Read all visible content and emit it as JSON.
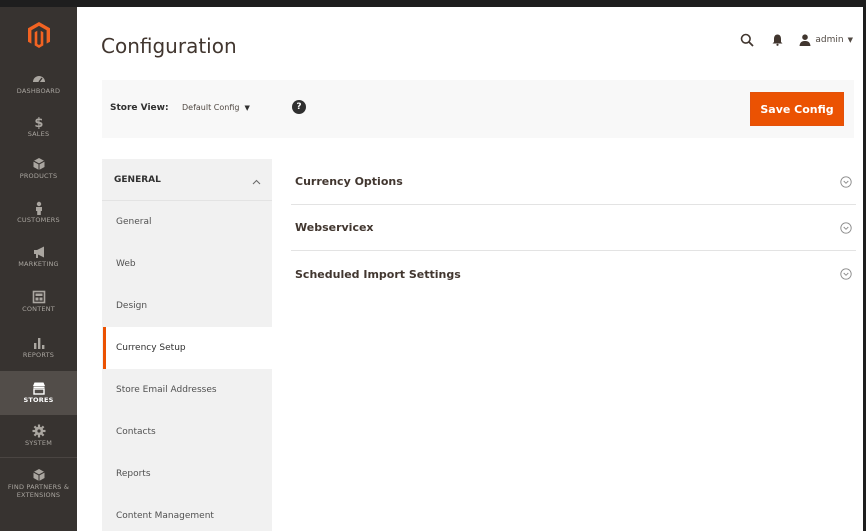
{
  "sidebar": {
    "items": [
      {
        "label": "DASHBOARD",
        "icon": "dashboard-icon"
      },
      {
        "label": "SALES",
        "icon": "dollar-icon"
      },
      {
        "label": "PRODUCTS",
        "icon": "cube-icon"
      },
      {
        "label": "CUSTOMERS",
        "icon": "person-icon"
      },
      {
        "label": "MARKETING",
        "icon": "megaphone-icon"
      },
      {
        "label": "CONTENT",
        "icon": "layout-icon"
      },
      {
        "label": "REPORTS",
        "icon": "bar-chart-icon"
      },
      {
        "label": "STORES",
        "icon": "store-icon",
        "active": true
      },
      {
        "label": "SYSTEM",
        "icon": "gear-icon"
      },
      {
        "label": "FIND PARTNERS & EXTENSIONS",
        "icon": "cube-icon"
      }
    ]
  },
  "header": {
    "title": "Configuration",
    "admin_label": "admin"
  },
  "store_bar": {
    "label": "Store View:",
    "selected": "Default Config",
    "help": "?",
    "save_label": "Save Config"
  },
  "nav": {
    "group_title": "GENERAL",
    "items": [
      {
        "label": "General"
      },
      {
        "label": "Web"
      },
      {
        "label": "Design"
      },
      {
        "label": "Currency Setup",
        "active": true
      },
      {
        "label": "Store Email Addresses"
      },
      {
        "label": "Contacts"
      },
      {
        "label": "Reports"
      },
      {
        "label": "Content Management"
      }
    ]
  },
  "sections": [
    {
      "title": "Currency Options"
    },
    {
      "title": "Webservicex"
    },
    {
      "title": "Scheduled Import Settings"
    }
  ],
  "colors": {
    "accent": "#eb5202",
    "sidebar": "#373330",
    "sidebar_active": "#524d49"
  }
}
